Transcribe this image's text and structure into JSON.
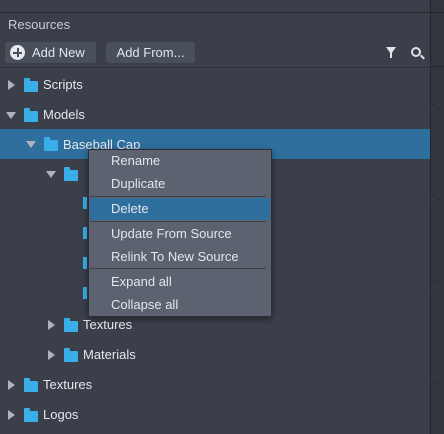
{
  "panel": {
    "title": "Resources"
  },
  "toolbar": {
    "add_new": "Add New",
    "add_from": "Add From...",
    "filter_icon": "filter-icon",
    "search_icon": "search-icon"
  },
  "tree": {
    "scripts": "Scripts",
    "models": "Models",
    "baseball_cap": "Baseball Cap",
    "textures_sub": "Textures",
    "materials_sub": "Materials",
    "textures": "Textures",
    "logos": "Logos"
  },
  "context_menu": {
    "rename": "Rename",
    "duplicate": "Duplicate",
    "delete": "Delete",
    "update_from_source": "Update From Source",
    "relink_to_new_source": "Relink To New Source",
    "expand_all": "Expand all",
    "collapse_all": "Collapse all"
  },
  "colors": {
    "background": "#3a3f49",
    "selection": "#2e6f9e",
    "folder": "#3aaee8",
    "menu": "#5c6270"
  }
}
